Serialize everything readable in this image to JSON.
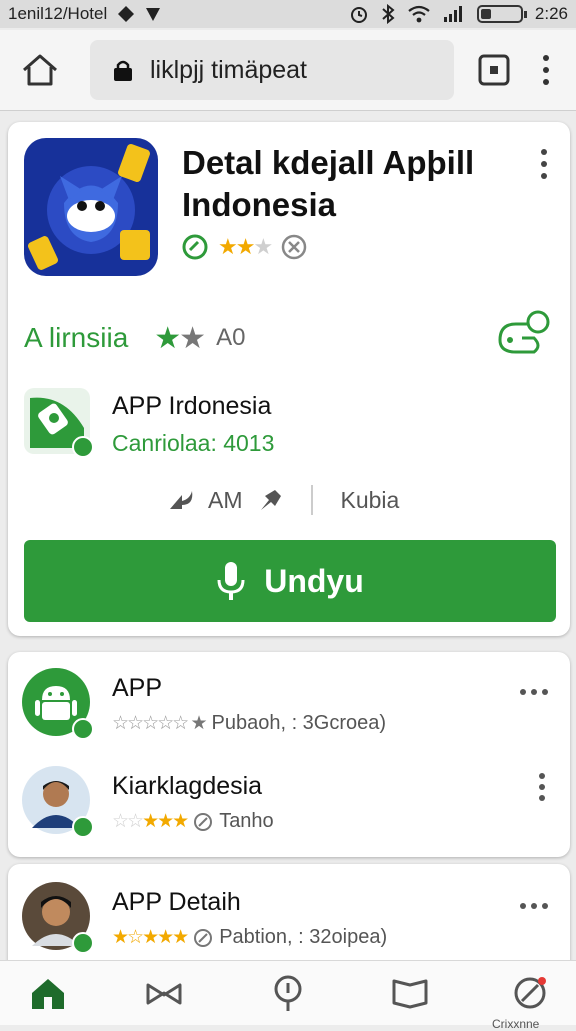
{
  "status": {
    "left_text": "1enil12/Hotel",
    "time": "2:26"
  },
  "browser": {
    "url": "liklpjj timäpeat"
  },
  "app": {
    "title": "Detal kdejall Apþill Indonesia",
    "section_label": "A lirnsiia",
    "section_count": "A0",
    "developer_name": "APP Irdonesia",
    "developer_sub": "Canriolaa: 4013",
    "meta_left": "AM",
    "meta_right": "Kubia",
    "download_label": "Undyu"
  },
  "list": [
    {
      "title": "APP",
      "meta": "Pubaoh, : 3Gcroea)"
    },
    {
      "title": "Kiarklagdesia",
      "meta": "Tanho"
    },
    {
      "title": "APP Detaih",
      "meta": "Pabtion, : 32oipea)"
    }
  ],
  "nav": {
    "label": "Crixxnne"
  },
  "colors": {
    "accent_green": "#2e9a3a",
    "star_gold": "#f2a900"
  },
  "icons": [
    "wifi-icon",
    "battery-icon",
    "home-icon",
    "lock-icon",
    "tabs-icon",
    "more-vert-icon",
    "microphone-icon",
    "share-icon",
    "bookmark-icon"
  ]
}
